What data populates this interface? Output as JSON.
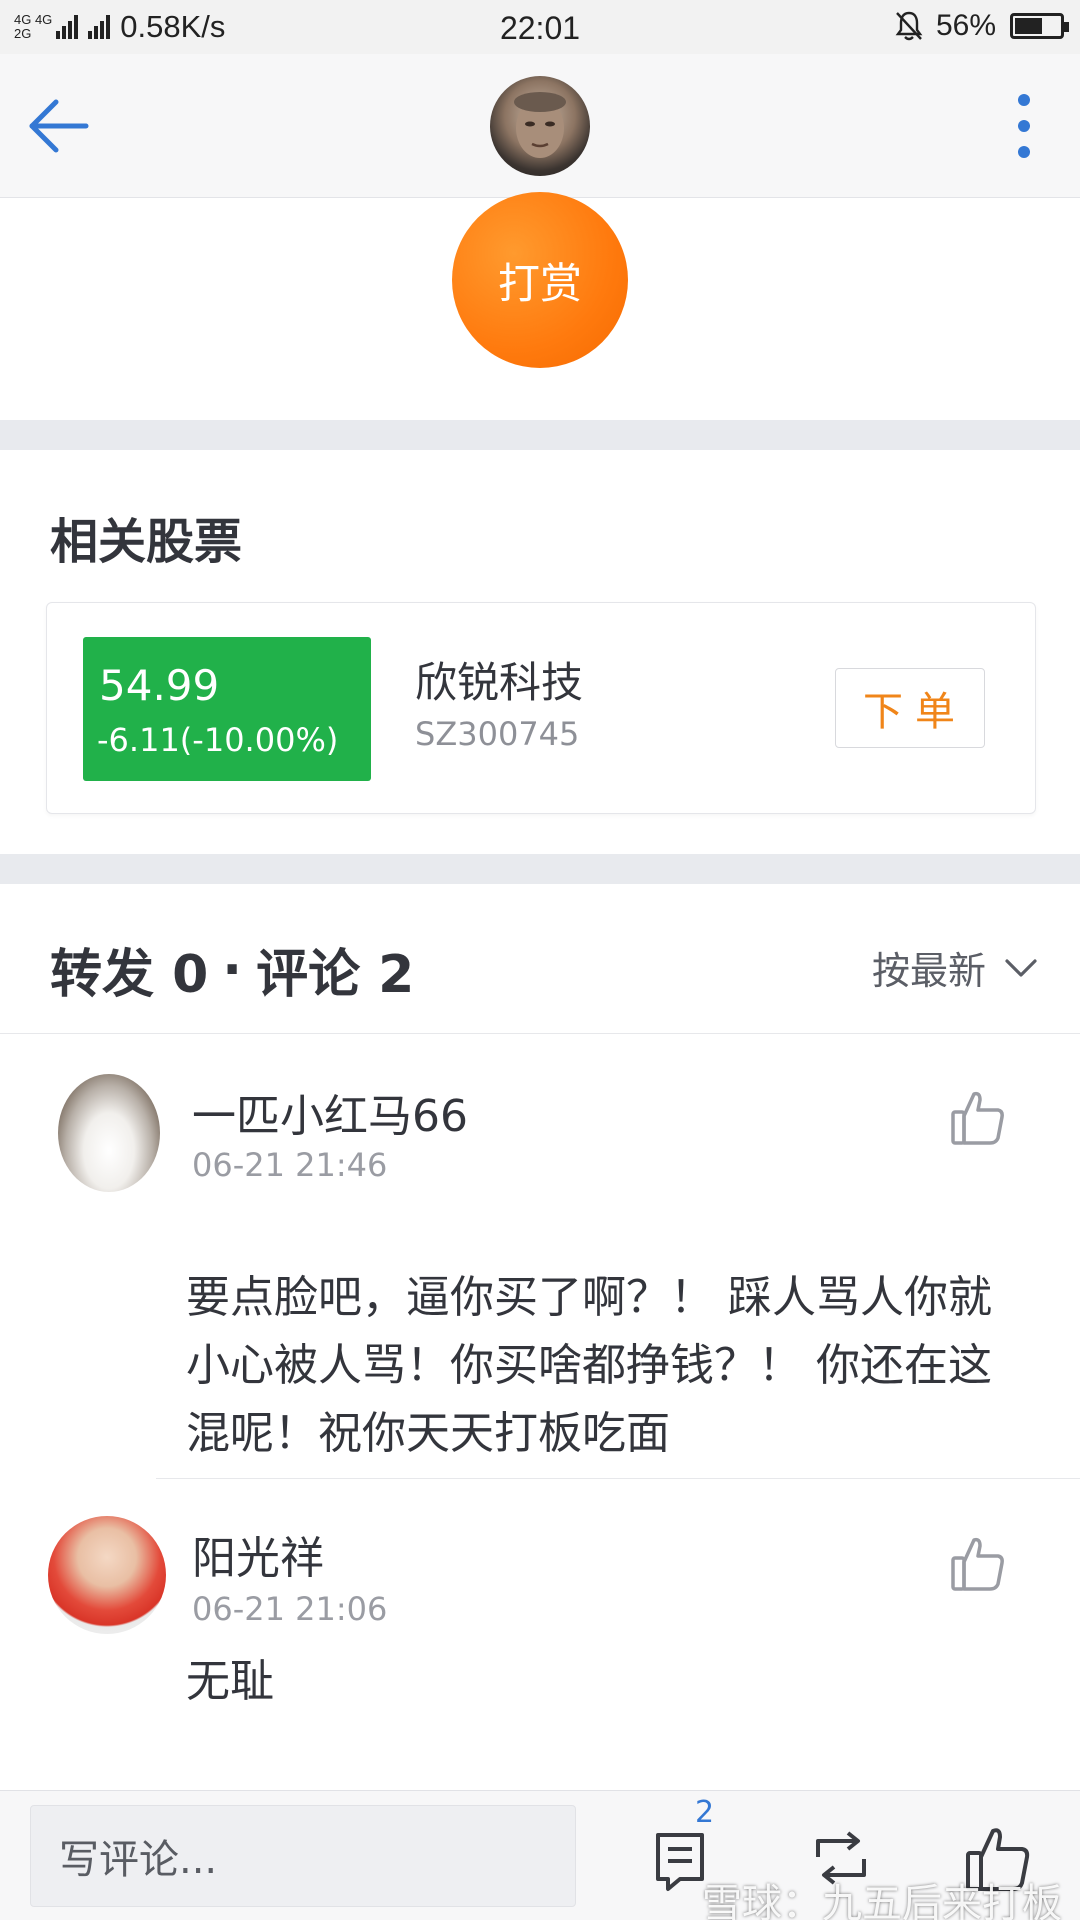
{
  "status_bar": {
    "network_top": "4G 4G",
    "network_bottom": "2G",
    "net_speed": "0.58K/s",
    "time": "22:01",
    "battery": "56%",
    "battery_level": 0.56
  },
  "nav": {
    "back_icon": "arrow-left-icon",
    "more_icon": "more-vertical-icon",
    "accent_color": "#3478d4"
  },
  "reward": {
    "label": "打赏",
    "color": "#ff7a0e"
  },
  "related_stocks": {
    "title": "相关股票",
    "stock": {
      "price": "54.99",
      "change": "-6.11(-10.00%)",
      "name": "欣锐科技",
      "code": "SZ300745",
      "order_label": "下单",
      "price_box_color": "#21b14a"
    }
  },
  "comments": {
    "forward_label": "转发 0",
    "separator": "·",
    "comment_label": "评论 2",
    "sort_label": "按最新",
    "items": [
      {
        "name": "一匹小红马66",
        "time": "06-21 21:46",
        "text": "要点脸吧，逼你买了啊？！ 踩人骂人你就小心被人骂！你买啥都挣钱？！ 你还在这混呢！祝你天天打板吃面"
      },
      {
        "name": "阳光祥",
        "time": "06-21 21:06",
        "text": "无耻"
      }
    ]
  },
  "bottom_bar": {
    "input_placeholder": "写评论...",
    "comment_badge": "2",
    "watermark": "雪球：九五后来打板"
  }
}
